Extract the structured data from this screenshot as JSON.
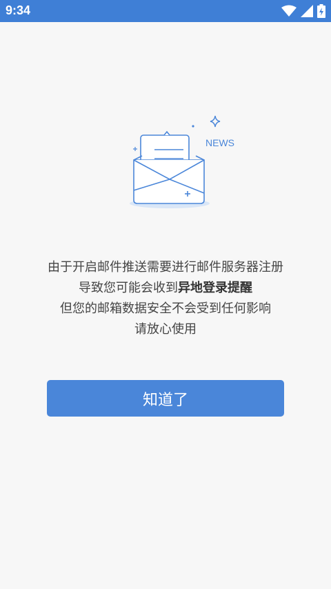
{
  "status_bar": {
    "time": "9:34",
    "icons": [
      "wifi-icon",
      "signal-icon",
      "battery-icon"
    ],
    "color": "#3f7fd6"
  },
  "illustration": {
    "news_label": "NEWS",
    "icon": "envelope-news-icon"
  },
  "message": {
    "line1": "由于开启邮件推送需要进行邮件服务器注册",
    "line2_prefix": "导致您可能会收到",
    "line2_bold": "异地登录提醒",
    "line3": "但您的邮箱数据安全不会受到任何影响",
    "line4": "请放心使用"
  },
  "button": {
    "label": "知道了",
    "color": "#4a86d9"
  }
}
